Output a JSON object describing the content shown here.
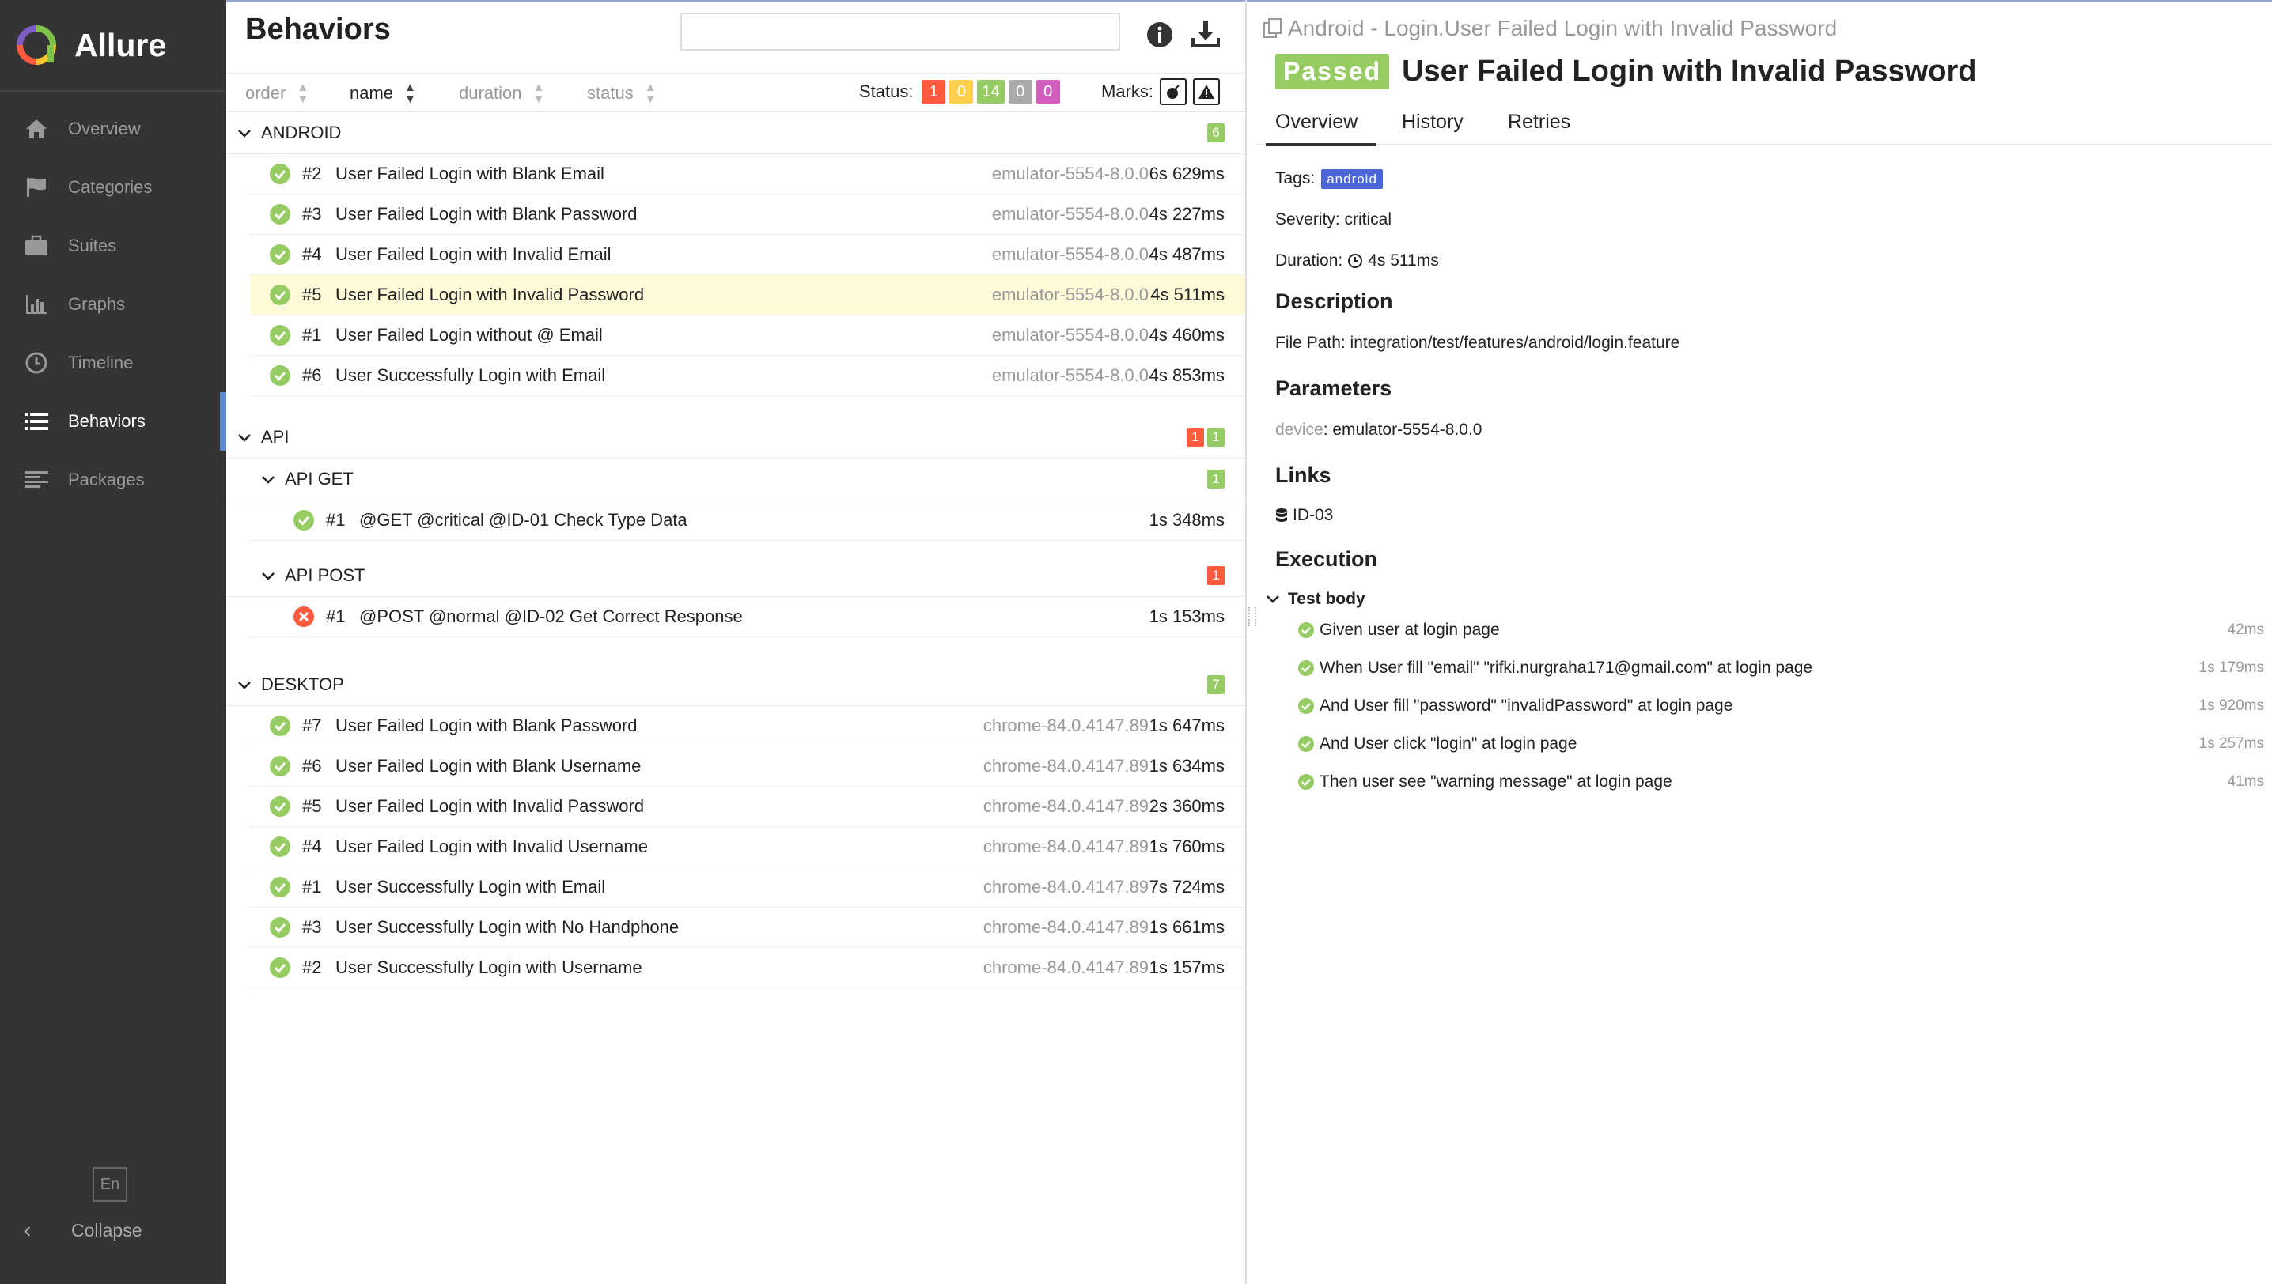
{
  "sidebar": {
    "brand": "Allure",
    "items": [
      {
        "label": "Overview",
        "icon": "home-icon"
      },
      {
        "label": "Categories",
        "icon": "flag-icon"
      },
      {
        "label": "Suites",
        "icon": "briefcase-icon"
      },
      {
        "label": "Graphs",
        "icon": "bar-chart-icon"
      },
      {
        "label": "Timeline",
        "icon": "clock-icon"
      },
      {
        "label": "Behaviors",
        "icon": "list-icon",
        "active": true
      },
      {
        "label": "Packages",
        "icon": "align-left-icon"
      }
    ],
    "language": "En",
    "collapse_label": "Collapse"
  },
  "behaviors": {
    "title": "Behaviors",
    "search_placeholder": "",
    "sort": {
      "order": "order",
      "name": "name",
      "duration": "duration",
      "status": "status"
    },
    "status_label": "Status:",
    "status_counts": [
      {
        "value": "1",
        "color": "#fd5a3e"
      },
      {
        "value": "0",
        "color": "#ffd050"
      },
      {
        "value": "14",
        "color": "#97cc64"
      },
      {
        "value": "0",
        "color": "#aaaaaa"
      },
      {
        "value": "0",
        "color": "#d35ebe"
      }
    ],
    "marks_label": "Marks:",
    "groups": {
      "android": {
        "label": "ANDROID",
        "badge": "6",
        "rows": [
          {
            "num": "#2",
            "name": "User Failed Login with Blank Email",
            "param": "emulator-5554-8.0.0",
            "dur": "6s 629ms"
          },
          {
            "num": "#3",
            "name": "User Failed Login with Blank Password",
            "param": "emulator-5554-8.0.0",
            "dur": "4s 227ms"
          },
          {
            "num": "#4",
            "name": "User Failed Login with Invalid Email",
            "param": "emulator-5554-8.0.0",
            "dur": "4s 487ms"
          },
          {
            "num": "#5",
            "name": "User Failed Login with Invalid Password",
            "param": "emulator-5554-8.0.0",
            "dur": "4s 511ms"
          },
          {
            "num": "#1",
            "name": "User Failed Login without @ Email",
            "param": "emulator-5554-8.0.0",
            "dur": "4s 460ms"
          },
          {
            "num": "#6",
            "name": "User Successfully Login with Email",
            "param": "emulator-5554-8.0.0",
            "dur": "4s 853ms"
          }
        ]
      },
      "api": {
        "label": "API",
        "badge_failed": "1",
        "badge_passed": "1",
        "get": {
          "label": "API GET",
          "badge": "1",
          "row": {
            "num": "#1",
            "name": "@GET @critical @ID-01 Check Type Data",
            "dur": "1s 348ms"
          }
        },
        "post": {
          "label": "API POST",
          "badge": "1",
          "row": {
            "num": "#1",
            "name": "@POST @normal @ID-02 Get Correct Response",
            "dur": "1s 153ms"
          }
        }
      },
      "desktop": {
        "label": "DESKTOP",
        "badge": "7",
        "rows": [
          {
            "num": "#7",
            "name": "User Failed Login with Blank Password",
            "param": "chrome-84.0.4147.89",
            "dur": "1s 647ms"
          },
          {
            "num": "#6",
            "name": "User Failed Login with Blank Username",
            "param": "chrome-84.0.4147.89",
            "dur": "1s 634ms"
          },
          {
            "num": "#5",
            "name": "User Failed Login with Invalid Password",
            "param": "chrome-84.0.4147.89",
            "dur": "2s 360ms"
          },
          {
            "num": "#4",
            "name": "User Failed Login with Invalid Username",
            "param": "chrome-84.0.4147.89",
            "dur": "1s 760ms"
          },
          {
            "num": "#1",
            "name": "User Successfully Login with Email",
            "param": "chrome-84.0.4147.89",
            "dur": "7s 724ms"
          },
          {
            "num": "#3",
            "name": "User Successfully Login with No Handphone",
            "param": "chrome-84.0.4147.89",
            "dur": "1s 661ms"
          },
          {
            "num": "#2",
            "name": "User Successfully Login with Username",
            "param": "chrome-84.0.4147.89",
            "dur": "1s 157ms"
          }
        ]
      }
    }
  },
  "detail": {
    "breadcrumb": "Android - Login.User Failed Login with Invalid Password",
    "status": "Passed",
    "title": "User Failed Login with Invalid Password",
    "tabs": [
      "Overview",
      "History",
      "Retries"
    ],
    "tags_label": "Tags:",
    "tag": "android",
    "severity": "Severity: critical",
    "duration_label": "Duration:",
    "duration": "4s 511ms",
    "description_heading": "Description",
    "file_path": "File Path: integration/test/features/android/login.feature",
    "parameters_heading": "Parameters",
    "param_key": "device",
    "param_value": ": emulator-5554-8.0.0",
    "links_heading": "Links",
    "link": "ID-03",
    "execution_heading": "Execution",
    "test_body": "Test body",
    "steps": [
      {
        "text": "Given user at login page",
        "dur": "42ms"
      },
      {
        "text": "When User fill \"email\" \"rifki.nurgraha171@gmail.com\" at login page",
        "dur": "1s 179ms"
      },
      {
        "text": "And User fill \"password\" \"invalidPassword\" at login page",
        "dur": "1s 920ms"
      },
      {
        "text": "And User click \"login\" at login page",
        "dur": "1s 257ms"
      },
      {
        "text": "Then user see \"warning message\" at login page",
        "dur": "41ms"
      }
    ]
  }
}
